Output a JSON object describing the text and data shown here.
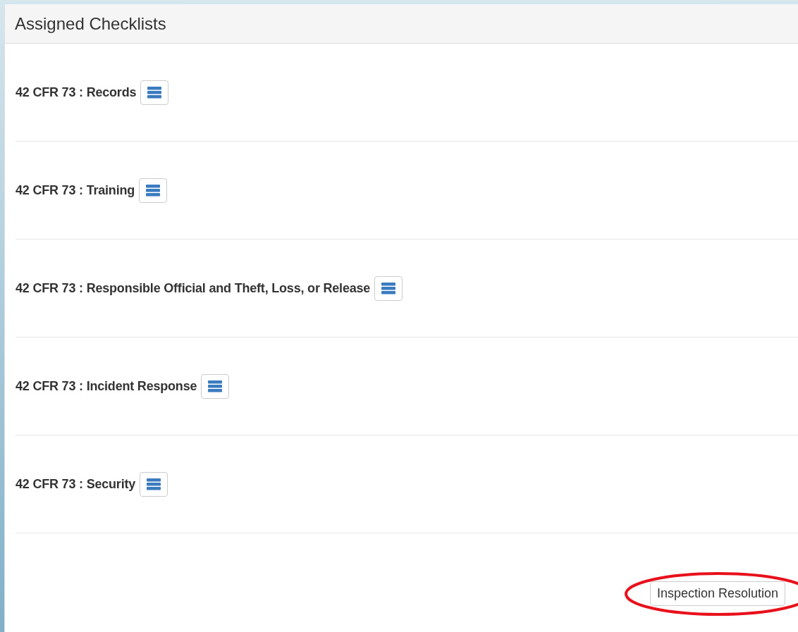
{
  "panel": {
    "title": "Assigned Checklists"
  },
  "checklists": [
    {
      "label": "42 CFR 73 : Records"
    },
    {
      "label": "42 CFR 73 : Training"
    },
    {
      "label": "42 CFR 73 : Responsible Official and Theft, Loss, or Release"
    },
    {
      "label": "42 CFR 73 : Incident Response"
    },
    {
      "label": "42 CFR 73 : Security"
    }
  ],
  "footer_button": {
    "label": "Inspection Resolution",
    "highlighted": true
  }
}
